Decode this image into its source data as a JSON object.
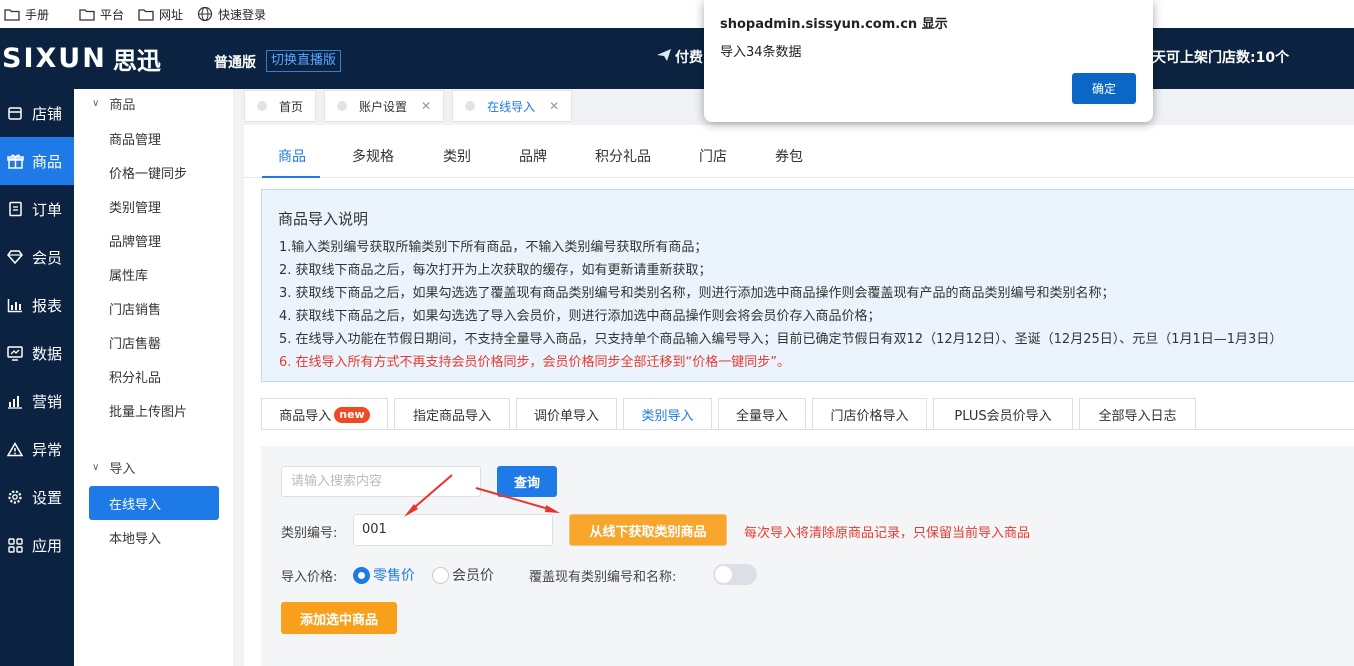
{
  "bookmarks": [
    {
      "label": "手册",
      "icon": "folder-icon"
    },
    {
      "label": "平台",
      "icon": "folder-icon"
    },
    {
      "label": "网址",
      "icon": "folder-icon"
    },
    {
      "label": "快速登录",
      "icon": "globe-icon"
    }
  ],
  "header": {
    "logo_en": "SIXUN",
    "logo_cn": "思迅",
    "edition": "普通版",
    "switch_live": "切换直播版",
    "paid": "付费",
    "stores_label": "可上架门店数:",
    "stores_value": "10个",
    "stores_prefix": "天"
  },
  "sidebar": {
    "items": [
      {
        "label": "店铺",
        "icon": "store-icon"
      },
      {
        "label": "商品",
        "icon": "gift-icon"
      },
      {
        "label": "订单",
        "icon": "order-icon"
      },
      {
        "label": "会员",
        "icon": "diamond-icon"
      },
      {
        "label": "报表",
        "icon": "report-icon"
      },
      {
        "label": "数据",
        "icon": "data-icon"
      },
      {
        "label": "营销",
        "icon": "marketing-icon"
      },
      {
        "label": "异常",
        "icon": "warning-icon"
      },
      {
        "label": "设置",
        "icon": "gear-icon"
      },
      {
        "label": "应用",
        "icon": "apps-icon"
      }
    ]
  },
  "submenu": {
    "group1": "商品",
    "group1_items": [
      "商品管理",
      "价格一键同步",
      "类别管理",
      "品牌管理",
      "属性库",
      "门店销售",
      "门店售罄",
      "积分礼品",
      "批量上传图片"
    ],
    "group2": "导入",
    "group2_active": "在线导入",
    "group2_item": "本地导入"
  },
  "page_tabs": [
    {
      "label": "首页",
      "closable": false
    },
    {
      "label": "账户设置",
      "closable": true
    },
    {
      "label": "在线导入",
      "closable": true
    }
  ],
  "subtabs": [
    "商品",
    "多规格",
    "类别",
    "品牌",
    "积分礼品",
    "门店",
    "券包"
  ],
  "notice": {
    "title": "商品导入说明",
    "lines": [
      "1.输入类别编号获取所输类别下所有商品，不输入类别编号获取所有商品；",
      "2. 获取线下商品之后，每次打开为上次获取的缓存，如有更新请重新获取；",
      "3. 获取线下商品之后，如果勾选选了覆盖现有商品类别编号和类别名称，则进行添加选中商品操作则会覆盖现有产品的商品类别编号和类别名称；",
      "4. 获取线下商品之后，如果勾选选了导入会员价，则进行添加选中商品操作则会将会员价存入商品价格；",
      "5. 在线导入功能在节假日期间，不支持全量导入商品，只支持单个商品输入编号导入；目前已确定节假日有双12（12月12日）、圣诞（12月25日）、元旦（1月1日—1月3日）",
      "6. 在线导入所有方式不再支持会员价格同步，会员价格同步全部迁移到“价格一键同步”。"
    ]
  },
  "import_tabs": [
    {
      "label": "商品导入",
      "badge": "new"
    },
    {
      "label": "指定商品导入"
    },
    {
      "label": "调价单导入"
    },
    {
      "label": "类别导入"
    },
    {
      "label": "全量导入"
    },
    {
      "label": "门店价格导入"
    },
    {
      "label": "PLUS会员价导入"
    },
    {
      "label": "全部导入日志"
    }
  ],
  "form": {
    "search_placeholder": "请输入搜索内容",
    "query_btn": "查询",
    "category_label": "类别编号:",
    "category_value": "001",
    "fetch_btn": "从线下获取类别商品",
    "warning": "每次导入将清除原商品记录，只保留当前导入商品",
    "price_label": "导入价格:",
    "price_options": [
      "零售价",
      "会员价"
    ],
    "cover_label": "覆盖现有类别编号和名称:",
    "add_btn": "添加选中商品"
  },
  "dialog": {
    "title": "shopadmin.sissyun.com.cn 显示",
    "message": "导入34条数据",
    "ok": "确定"
  },
  "colors": {
    "primary": "#1e7ae6",
    "nav": "#0b2340",
    "orange": "#f8a52b",
    "red": "#e83a30"
  }
}
